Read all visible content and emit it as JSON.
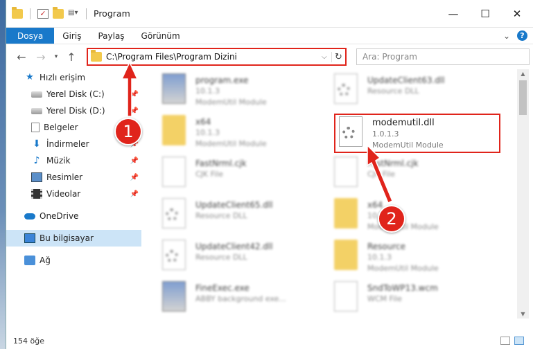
{
  "window": {
    "title": "Program",
    "controls": {
      "minimize": "—",
      "maximize": "☐",
      "close": "✕"
    }
  },
  "ribbon": {
    "tabs": [
      "Dosya",
      "Giriş",
      "Paylaş",
      "Görünüm"
    ],
    "accent": "#1979ca",
    "help": "?"
  },
  "address": {
    "path": "C:\\Program Files\\Program Dizini",
    "search_placeholder": "Ara: Program"
  },
  "nav": {
    "items": [
      {
        "label": "Hızlı erişim",
        "icon": "star-icon"
      },
      {
        "label": "Yerel Disk (C:)",
        "icon": "disk-icon",
        "pinned": true
      },
      {
        "label": "Yerel Disk (D:)",
        "icon": "disk-icon",
        "pinned": true
      },
      {
        "label": "Belgeler",
        "icon": "document-icon",
        "pinned": true
      },
      {
        "label": "İndirmeler",
        "icon": "download-icon",
        "pinned": true
      },
      {
        "label": "Müzik",
        "icon": "music-icon",
        "pinned": true
      },
      {
        "label": "Resimler",
        "icon": "pictures-icon",
        "pinned": true
      },
      {
        "label": "Videolar",
        "icon": "video-icon",
        "pinned": true
      },
      {
        "label": "OneDrive",
        "icon": "cloud-icon"
      },
      {
        "label": "Bu bilgisayar",
        "icon": "computer-icon",
        "selected": true
      },
      {
        "label": "Ağ",
        "icon": "network-icon"
      }
    ]
  },
  "files": [
    {
      "name": "program.exe",
      "line2": "10.1.3",
      "line3": "ModemUtil Module",
      "icon": "exe-icon"
    },
    {
      "name": "UpdateClient63.dll",
      "line2": "Resource DLL",
      "line3": "",
      "icon": "dll-icon"
    },
    {
      "name": "x64",
      "line2": "10.1.3",
      "line3": "ModemUtil Module",
      "icon": "folder-icon"
    },
    {
      "name": "modemutil.dll",
      "line2": "1.0.1.3",
      "line3": "ModemUtil Module",
      "icon": "dll-icon"
    },
    {
      "name": "FastNrml.cjk",
      "line2": "CJK File",
      "line3": "",
      "icon": "file-icon"
    },
    {
      "name": "FastNrml.cjk",
      "line2": "CJK File",
      "line3": "",
      "icon": "file-icon"
    },
    {
      "name": "UpdateClient65.dll",
      "line2": "Resource DLL",
      "line3": "",
      "icon": "dll-icon"
    },
    {
      "name": "x64",
      "line2": "10.1.3",
      "line3": "ModemUtil Module",
      "icon": "folder-icon"
    },
    {
      "name": "UpdateClient42.dll",
      "line2": "Resource DLL",
      "line3": "",
      "icon": "dll-icon"
    },
    {
      "name": "Resource",
      "line2": "10.1.3",
      "line3": "ModemUtil Module",
      "icon": "folder-icon"
    },
    {
      "name": "FineExec.exe",
      "line2": "ABBY background exe...",
      "line3": "",
      "icon": "exe-icon"
    },
    {
      "name": "SndToWP13.wcm",
      "line2": "WCM File",
      "line3": "",
      "icon": "file-icon"
    }
  ],
  "status": {
    "count": "154 öğe"
  },
  "annotations": {
    "step1": "1",
    "step2": "2",
    "color": "#e0241b"
  }
}
